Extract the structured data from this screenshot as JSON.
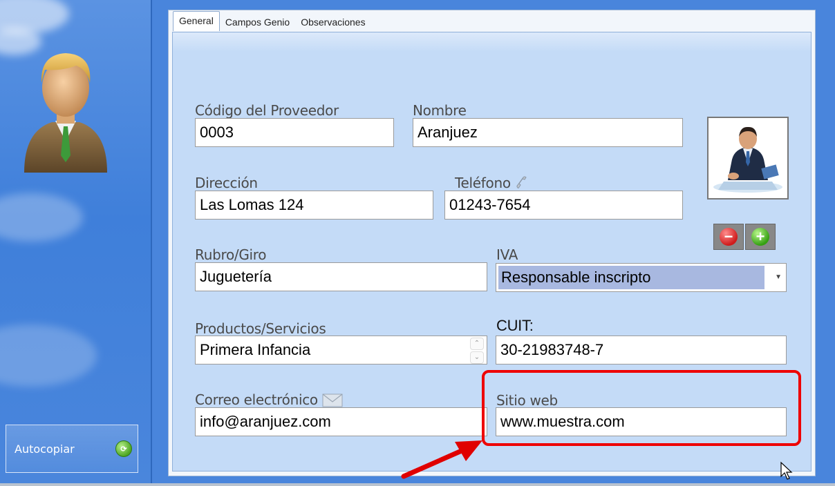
{
  "sidebar": {
    "autocopiar_label": "Autocopiar",
    "autocopiar_icon": "sync-icon"
  },
  "tabs": [
    {
      "label": "General",
      "active": true
    },
    {
      "label": "Campos Genio",
      "active": false
    },
    {
      "label": "Observaciones",
      "active": false
    }
  ],
  "form": {
    "codigo": {
      "label": "Código del Proveedor",
      "value": "0003"
    },
    "nombre": {
      "label": "Nombre",
      "value": "Aranjuez"
    },
    "direccion": {
      "label": "Dirección",
      "value": "Las Lomas 124"
    },
    "telefono": {
      "label": "Teléfono",
      "value": "01243-7654"
    },
    "rubro": {
      "label": "Rubro/Giro",
      "value": "Juguetería"
    },
    "iva": {
      "label": "IVA",
      "value": "Responsable inscripto"
    },
    "productos": {
      "label": "Productos/Servicios",
      "value": "Primera Infancia"
    },
    "cuit": {
      "label": "CUIT:",
      "value": "30-21983748-7"
    },
    "correo": {
      "label": "Correo electrónico",
      "value": "info@aranjuez.com"
    },
    "sitio": {
      "label": "Sitio web",
      "value": "www.muestra.com"
    }
  },
  "colors": {
    "highlight": "#e00000",
    "content_bg": "#c4dbf7",
    "iva_selected_bg": "#a8b8e0"
  }
}
